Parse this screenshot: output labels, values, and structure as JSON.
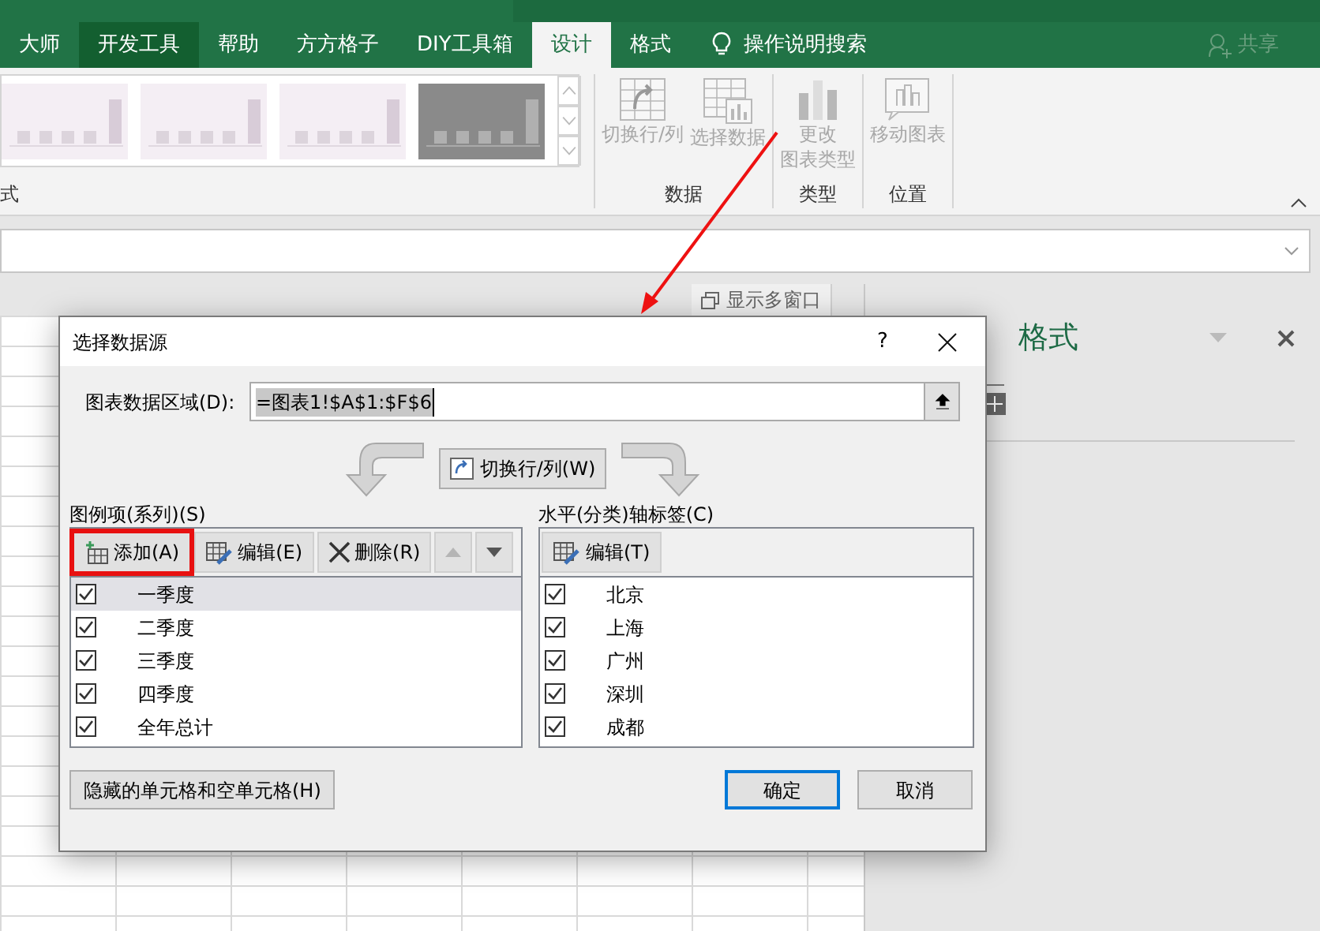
{
  "ribbon_tabs": [
    {
      "label": "大师",
      "selected": false,
      "hovered": false
    },
    {
      "label": "开发工具",
      "selected": false,
      "hovered": true
    },
    {
      "label": "帮助",
      "selected": false,
      "hovered": false
    },
    {
      "label": "方方格子",
      "selected": false,
      "hovered": false
    },
    {
      "label": "DIY工具箱",
      "selected": false,
      "hovered": false
    },
    {
      "label": "设计",
      "selected": true,
      "hovered": false
    },
    {
      "label": "格式",
      "selected": false,
      "hovered": false
    }
  ],
  "tell_me": "操作说明搜索",
  "share": "共享",
  "ribbon": {
    "style_group_label": "式",
    "groups": [
      {
        "label": "数据",
        "commands": [
          {
            "kind": "switch",
            "lines": [
              "切换行/列"
            ],
            "disabled": true
          },
          {
            "kind": "select",
            "lines": [
              "选择数据"
            ],
            "disabled": true
          }
        ]
      },
      {
        "label": "类型",
        "commands": [
          {
            "kind": "type",
            "lines": [
              "更改",
              "图表类型"
            ],
            "disabled": true
          }
        ]
      },
      {
        "label": "位置",
        "commands": [
          {
            "kind": "move",
            "lines": [
              "移动图表"
            ],
            "disabled": true
          }
        ]
      }
    ]
  },
  "sheet": {
    "window_button": "显示多窗口"
  },
  "format_pane": {
    "title": "格式"
  },
  "dialog": {
    "title": "选择数据源",
    "help": "?",
    "data_range_label": "图表数据区域(D):",
    "data_range_value": "=图表1!$A$1:$F$6",
    "switch_button": "切换行/列(W)",
    "legend": {
      "label": "图例项(系列)(S)",
      "buttons": [
        {
          "kind": "add",
          "label": "添加(A)",
          "highlighted": true
        },
        {
          "kind": "edit",
          "label": "编辑(E)",
          "highlighted": false
        },
        {
          "kind": "delete",
          "label": "删除(R)",
          "highlighted": false
        }
      ],
      "move_buttons": [
        {
          "kind": "up",
          "disabled": true
        },
        {
          "kind": "down",
          "disabled": false
        }
      ],
      "items": [
        {
          "label": "一季度",
          "checked": true,
          "selected": true
        },
        {
          "label": "二季度",
          "checked": true,
          "selected": false
        },
        {
          "label": "三季度",
          "checked": true,
          "selected": false
        },
        {
          "label": "四季度",
          "checked": true,
          "selected": false
        },
        {
          "label": "全年总计",
          "checked": true,
          "selected": false
        }
      ]
    },
    "axis": {
      "label": "水平(分类)轴标签(C)",
      "edit_button": "编辑(T)",
      "items": [
        {
          "label": "北京",
          "checked": true,
          "selected": false
        },
        {
          "label": "上海",
          "checked": true,
          "selected": false
        },
        {
          "label": "广州",
          "checked": true,
          "selected": false
        },
        {
          "label": "深圳",
          "checked": true,
          "selected": false
        },
        {
          "label": "成都",
          "checked": true,
          "selected": false
        }
      ]
    },
    "hidden_cells_button": "隐藏的单元格和空单元格(H)",
    "ok_button": "确定",
    "cancel_button": "取消"
  }
}
